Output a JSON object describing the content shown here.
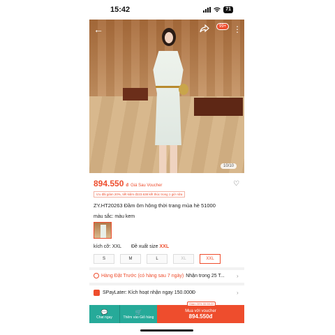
{
  "status_bar": {
    "time": "15:42",
    "battery": "71"
  },
  "header": {
    "cart_count": "99+",
    "image_counter": "10/10"
  },
  "product": {
    "price": "894.550",
    "price_unit": "đ",
    "price_note": "Giá Sau Voucher",
    "promo_text": "Ưu đãi giảm 20%, tiết kiệm đ223.638 kết thúc trong 1 giờ nữa",
    "title": "ZY.HT20263 Đầm ôm hông thời trang mùa hè 51000",
    "color_label": "màu sắc: màu kem",
    "size_label": "kích cỡ: XXL",
    "size_suggest_prefix": "Đề xuất size",
    "size_suggest_value": "XXL",
    "sizes": [
      {
        "label": "S",
        "state": "normal"
      },
      {
        "label": "M",
        "state": "normal"
      },
      {
        "label": "L",
        "state": "normal"
      },
      {
        "label": "XL",
        "state": "disabled"
      },
      {
        "label": "XXL",
        "state": "selected"
      }
    ]
  },
  "shipping": {
    "preorder_text": "Hàng Đặt Trước (có hàng sau 7 ngày)",
    "receive_text": "Nhận trong 25 T..."
  },
  "spaylater": {
    "text": "SPayLater: Kích hoạt nhận ngay 150.000Đ"
  },
  "bottom_bar": {
    "chat_label": "Chat ngay",
    "cart_label": "Thêm vào Giỏ hàng",
    "buy_label": "Mua với voucher",
    "buy_price": "894.550đ",
    "discount_tag": "Giảm 20%  00:59:22"
  },
  "colors": {
    "accent": "#ee4d2d",
    "teal": "#26aa99"
  }
}
